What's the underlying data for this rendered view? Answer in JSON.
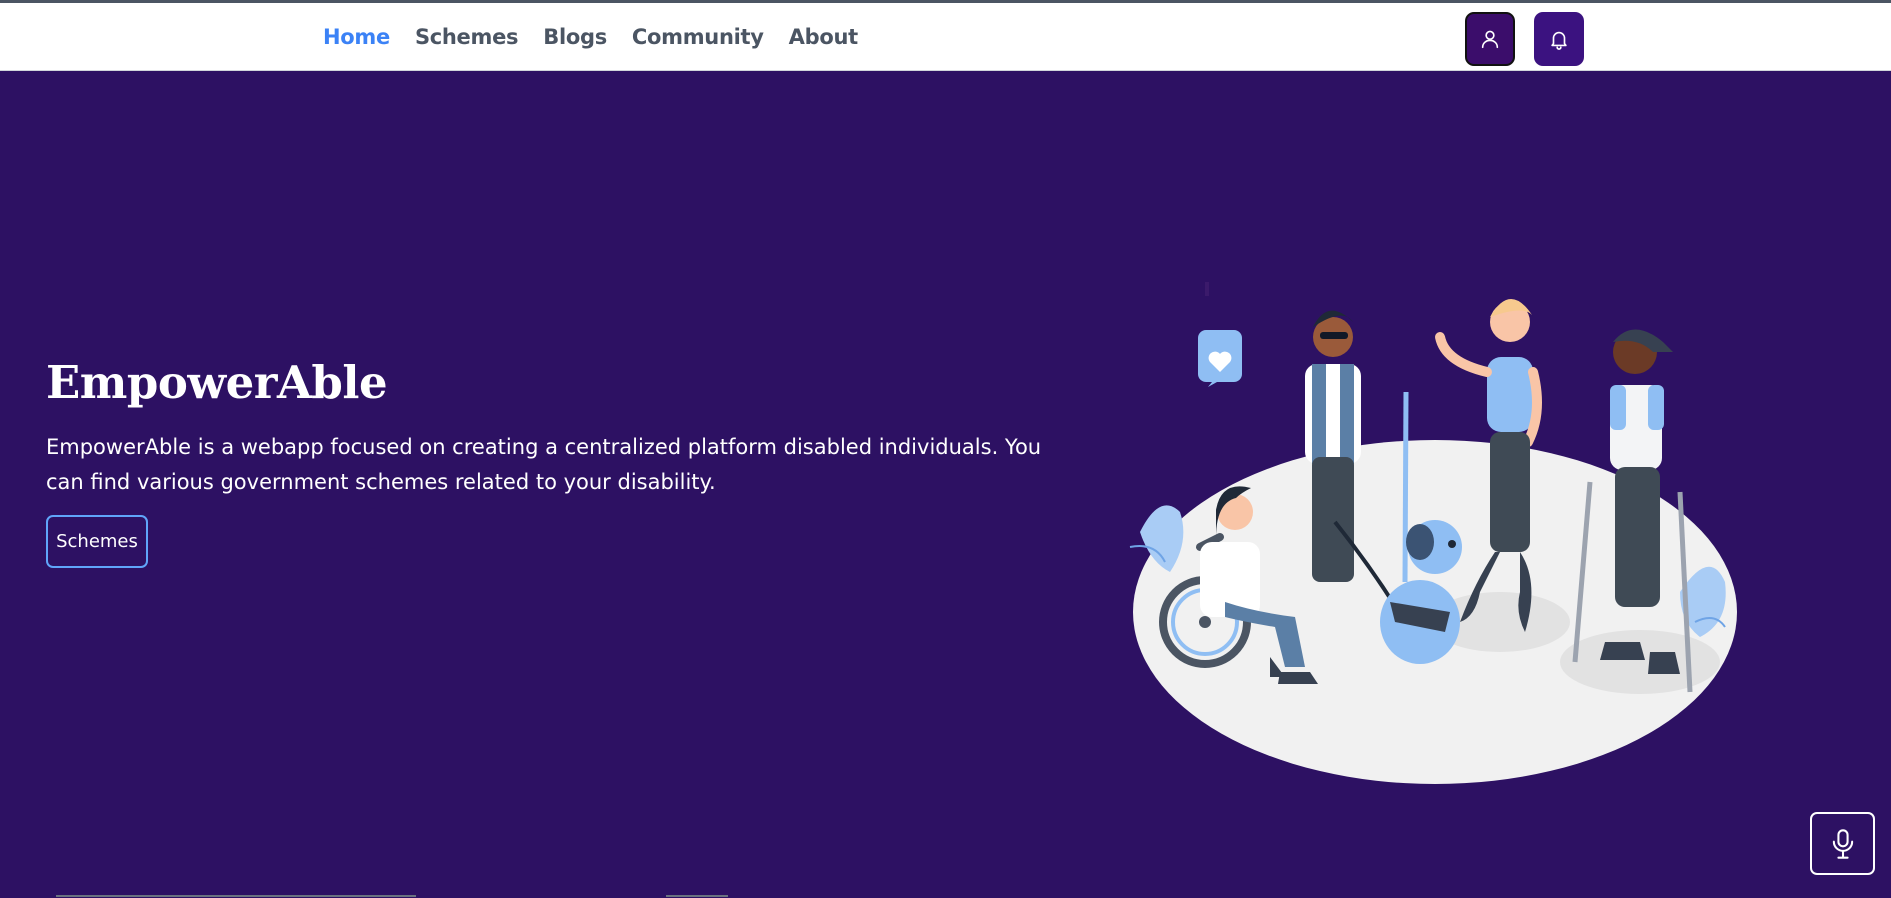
{
  "nav": {
    "links": [
      "Home",
      "Schemes",
      "Blogs",
      "Community",
      "About"
    ],
    "active": "Home"
  },
  "hero": {
    "title": "EmpowerAble",
    "description": "EmpowerAble is a webapp focused on creating a centralized platform disabled individuals. You can find various government schemes related to your disability.",
    "button_label": "Schemes"
  },
  "icons": {
    "profile": "user-icon",
    "notifications": "bell-icon",
    "voice": "microphone-icon"
  },
  "colors": {
    "background": "#2d1163",
    "nav_active": "#3b82f6",
    "nav_text": "#4b5563",
    "button_border": "#60a5fa"
  }
}
